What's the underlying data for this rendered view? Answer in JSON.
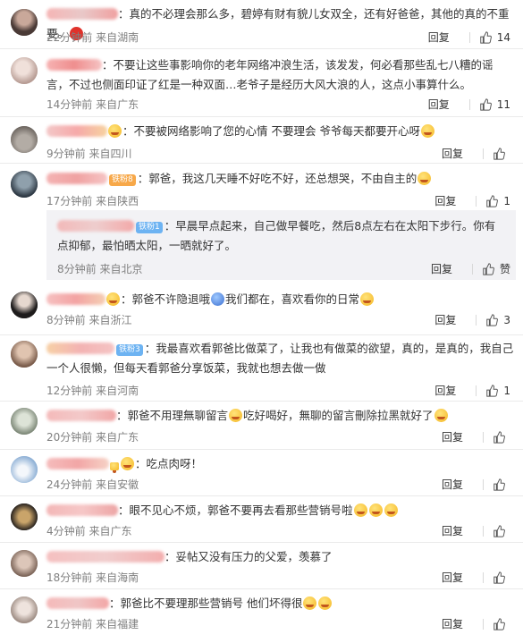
{
  "comments": [
    {
      "text": "：真的不必理会那么多，碧婷有财有貌儿女双全，还有好爸爸，其他的真的不重要。",
      "time": "22分钟前",
      "loc": "来自湖南",
      "reply": "回复",
      "likes": "14"
    },
    {
      "text": "：不要让这些事影响你的老年网络冲浪生活，该发发，何必看那些乱七八糟的谣言，不过也侧面印证了红是一种双面…老爷子是经历大风大浪的人，这点小事算什么。",
      "time": "14分钟前",
      "loc": "来自广东",
      "reply": "回复",
      "likes": "11"
    },
    {
      "text": "：不要被网络影响了您的心情 不要理会 爷爷每天都要开心呀",
      "time": "9分钟前",
      "loc": "来自四川",
      "reply": "回复",
      "likes": ""
    },
    {
      "text": "：郭爸，我这几天睡不好吃不好，还总想哭，不由自主的",
      "badge": "铁粉8",
      "time": "17分钟前",
      "loc": "来自陕西",
      "reply": "回复",
      "likes": "1"
    },
    {
      "text": "：郭爸不许隐退哦",
      "text2": "我们都在，喜欢看你的日常",
      "time": "8分钟前",
      "loc": "来自浙江",
      "reply": "回复",
      "likes": "3"
    },
    {
      "text": "：我最喜欢看郭爸比做菜了，让我也有做菜的欲望，真的，是真的，我自己一个人很懒，但每天看郭爸分享饭菜，我就也想去做一做",
      "badge": "铁粉3",
      "time": "12分钟前",
      "loc": "来自河南",
      "reply": "回复",
      "likes": "1"
    },
    {
      "text": "：郭爸不用理無聊留言",
      "text2": "吃好喝好，無聊的留言刪除拉黑就好了",
      "time": "20分钟前",
      "loc": "来自广东",
      "reply": "回复",
      "likes": ""
    },
    {
      "text": "：吃点肉呀！",
      "time": "24分钟前",
      "loc": "来自安徽",
      "reply": "回复",
      "likes": ""
    },
    {
      "text": "：眼不见心不烦，郭爸不要再去看那些营销号啦",
      "time": "4分钟前",
      "loc": "来自广东",
      "reply": "回复",
      "likes": ""
    },
    {
      "text": "：妥帖又没有压力的父爱，羡慕了",
      "time": "18分钟前",
      "loc": "来自海南",
      "reply": "回复",
      "likes": ""
    },
    {
      "text": "：郭爸比不要理那些营销号 他们坏得很",
      "time": "21分钟前",
      "loc": "来自福建",
      "reply": "回复",
      "likes": ""
    }
  ],
  "sub_reply": {
    "badge": "铁粉1",
    "text": "：早晨早点起来，自己做早餐吃，然后8点左右在太阳下步行。你有点抑郁，最怕晒太阳，一晒就好了。",
    "time": "8分钟前",
    "loc": "来自北京",
    "reply": "回复",
    "like_label": "赞"
  }
}
